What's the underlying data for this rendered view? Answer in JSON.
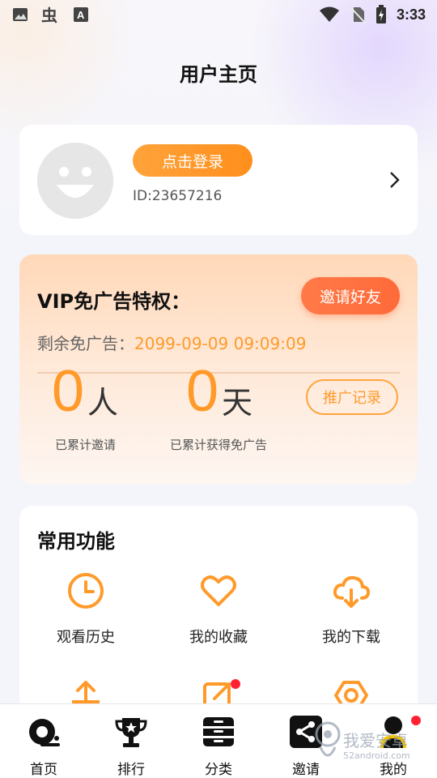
{
  "status_bar": {
    "time": "3:33",
    "left_icons": [
      "image-icon",
      "bug-icon",
      "font-icon"
    ],
    "right_icons": [
      "wifi-icon",
      "no-sim-icon",
      "battery-icon"
    ]
  },
  "header": {
    "title": "用户主页"
  },
  "profile": {
    "login_label": "点击登录",
    "user_id": "ID:23657216"
  },
  "vip": {
    "title": "VIP免广告特权：",
    "invite_label": "邀请好友",
    "remaining_label": "剩余免广告：",
    "remaining_value": "2099-09-09 09:09:09",
    "invites_count": "0",
    "invites_unit": "人",
    "invites_caption": "已累计邀请",
    "days_count": "0",
    "days_unit": "天",
    "days_caption": "已累计获得免广告",
    "record_label": "推广记录"
  },
  "functions": {
    "title": "常用功能",
    "items": [
      {
        "label": "观看历史",
        "icon": "clock-icon"
      },
      {
        "label": "我的收藏",
        "icon": "heart-icon"
      },
      {
        "label": "我的下载",
        "icon": "cloud-download-icon"
      }
    ],
    "partial_icons": [
      "upload-icon",
      "edit-icon",
      "settings-icon"
    ]
  },
  "bottom_nav": {
    "items": [
      {
        "label": "首页",
        "icon": "home-icon"
      },
      {
        "label": "排行",
        "icon": "trophy-icon"
      },
      {
        "label": "分类",
        "icon": "category-icon"
      },
      {
        "label": "邀请",
        "icon": "share-icon"
      },
      {
        "label": "我的",
        "icon": "user-icon"
      }
    ]
  },
  "watermark": {
    "text": "我爱安卓",
    "sub": "52android.com"
  },
  "colors": {
    "accent": "#ff9a2a",
    "invite": "#ff6a3a",
    "badge": "#ff2233"
  }
}
